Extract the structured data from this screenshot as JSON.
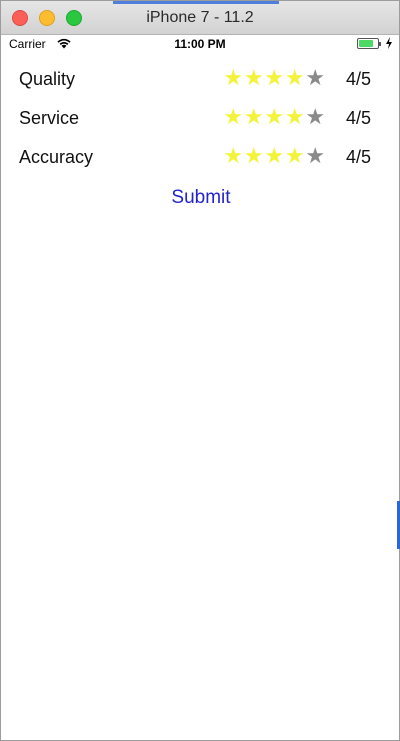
{
  "window": {
    "title": "iPhone 7 - 11.2"
  },
  "status_bar": {
    "carrier": "Carrier",
    "time": "11:00 PM",
    "battery_level": 0.8,
    "wifi_icon": "wifi-icon",
    "charging_icon": "charging-bolt-icon"
  },
  "ratings": [
    {
      "label": "Quality",
      "value_text": "4/5",
      "stars_filled": 4,
      "stars_total": 5
    },
    {
      "label": "Service",
      "value_text": "4/5",
      "stars_filled": 4,
      "stars_total": 5
    },
    {
      "label": "Accuracy",
      "value_text": "4/5",
      "stars_filled": 4,
      "stars_total": 5
    }
  ],
  "submit_label": "Submit",
  "colors": {
    "star_filled": "#f4f33b",
    "star_empty": "#8a8a8a",
    "link_blue": "#2223cf",
    "battery_green": "#4cd964"
  }
}
